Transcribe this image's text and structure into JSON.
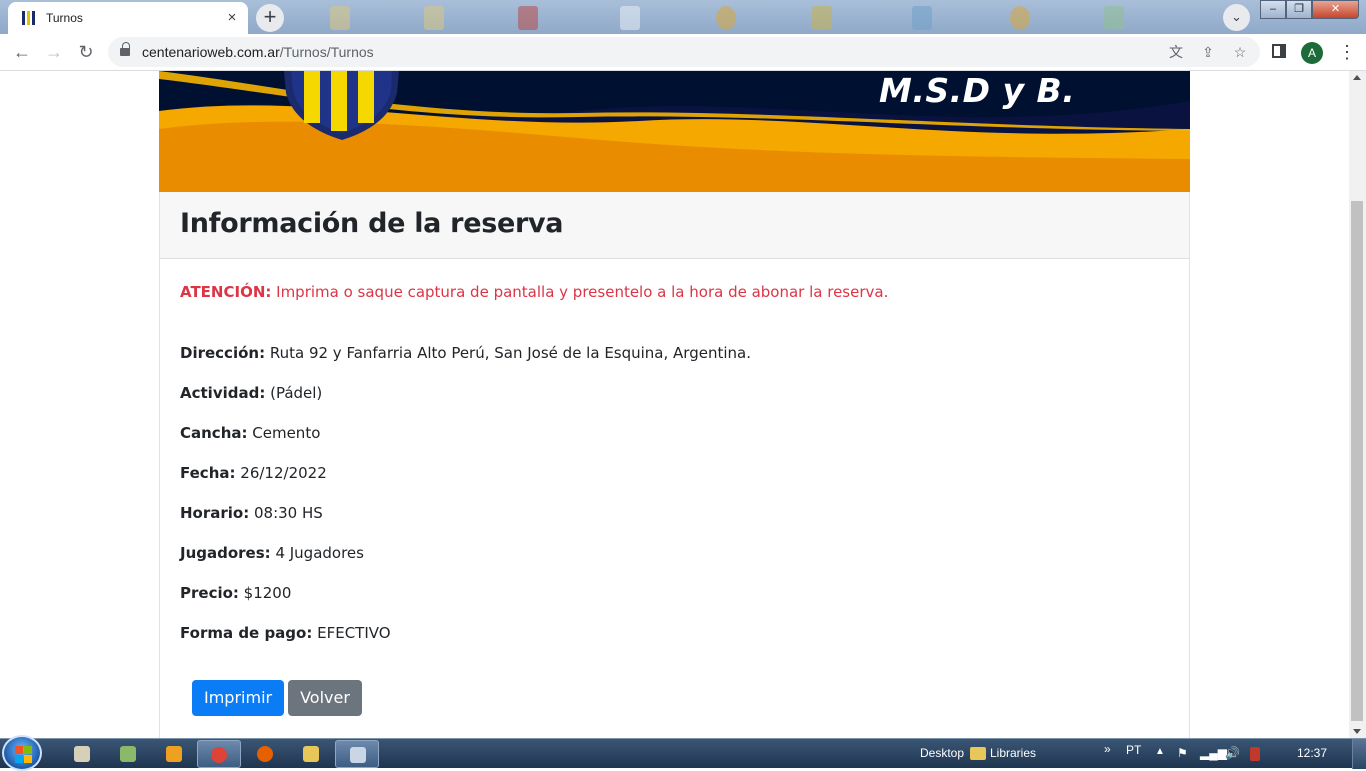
{
  "browser": {
    "tab_title": "Turnos",
    "tab_close": "×",
    "new_tab": "+",
    "url_host": "centenarioweb.com.ar",
    "url_path": "/Turnos/Turnos",
    "avatar_letter": "A",
    "window_min": "–",
    "window_max": "❐",
    "window_close": "✕"
  },
  "banner": {
    "title": "M.S.D y B."
  },
  "card": {
    "header": "Información de la reserva",
    "attention_label": "ATENCIÓN:",
    "attention_text": " Imprima o saque captura de pantalla y presentelo a la hora de abonar la reserva.",
    "fields": [
      {
        "label": "Dirección:",
        "value": " Ruta 92 y Fanfarria Alto Perú, San José de la Esquina, Argentina."
      },
      {
        "label": "Actividad:",
        "value": " (Pádel)"
      },
      {
        "label": "Cancha:",
        "value": " Cemento"
      },
      {
        "label": "Fecha:",
        "value": " 26/12/2022"
      },
      {
        "label": "Horario:",
        "value": " 08:30 HS"
      },
      {
        "label": "Jugadores:",
        "value": " 4 Jugadores"
      },
      {
        "label": "Precio:",
        "value": " $1200"
      },
      {
        "label": "Forma de pago:",
        "value": " EFECTIVO"
      }
    ],
    "print_button": "Imprimir",
    "back_button": "Volver"
  },
  "taskbar": {
    "desktop_label": "Desktop",
    "libraries_label": "Libraries",
    "language": "PT",
    "clock": "12:37"
  },
  "colors": {
    "accent_blue": "#0a7cf6",
    "secondary_gray": "#6c757d",
    "attention_red": "#dc3545",
    "banner_navy": "#0a1340",
    "banner_orange": "#f5a800"
  }
}
